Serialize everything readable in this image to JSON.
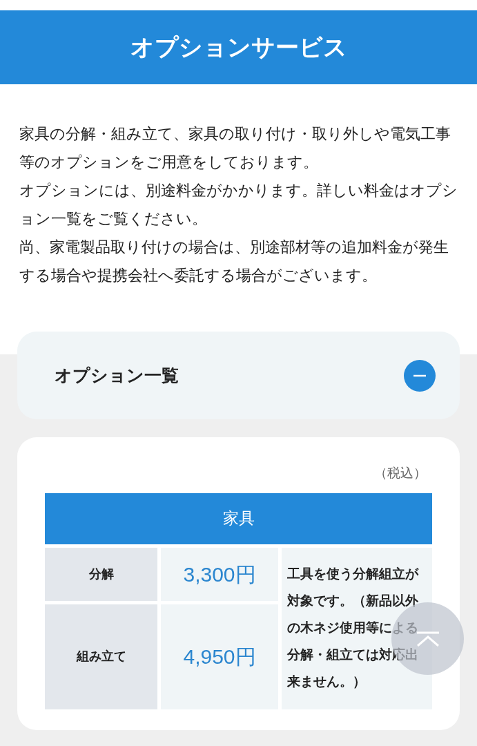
{
  "header": {
    "title": "オプションサービス"
  },
  "description": [
    "家具の分解・組み立て、家具の取り付け・取り外しや電気工事等のオプションをご用意をしております。",
    "オプションには、別途料金がかかります。詳しい料金はオプション一覧をご覧ください。",
    "尚、家電製品取り付けの場合は、別途部材等の追加料金が発生する場合や提携会社へ委託する場合がございます。"
  ],
  "accordion": {
    "title": "オプション一覧",
    "expanded": true
  },
  "tax_note": "（税込）",
  "table": {
    "heading": "家具",
    "rows": [
      {
        "label": "分解",
        "price": "3,300円"
      },
      {
        "label": "組み立て",
        "price": "4,950円"
      }
    ],
    "note": "工具を使う分解組立が対象です。（新品以外の木ネジ使用等による分解・組立ては対応出来ません。）"
  }
}
